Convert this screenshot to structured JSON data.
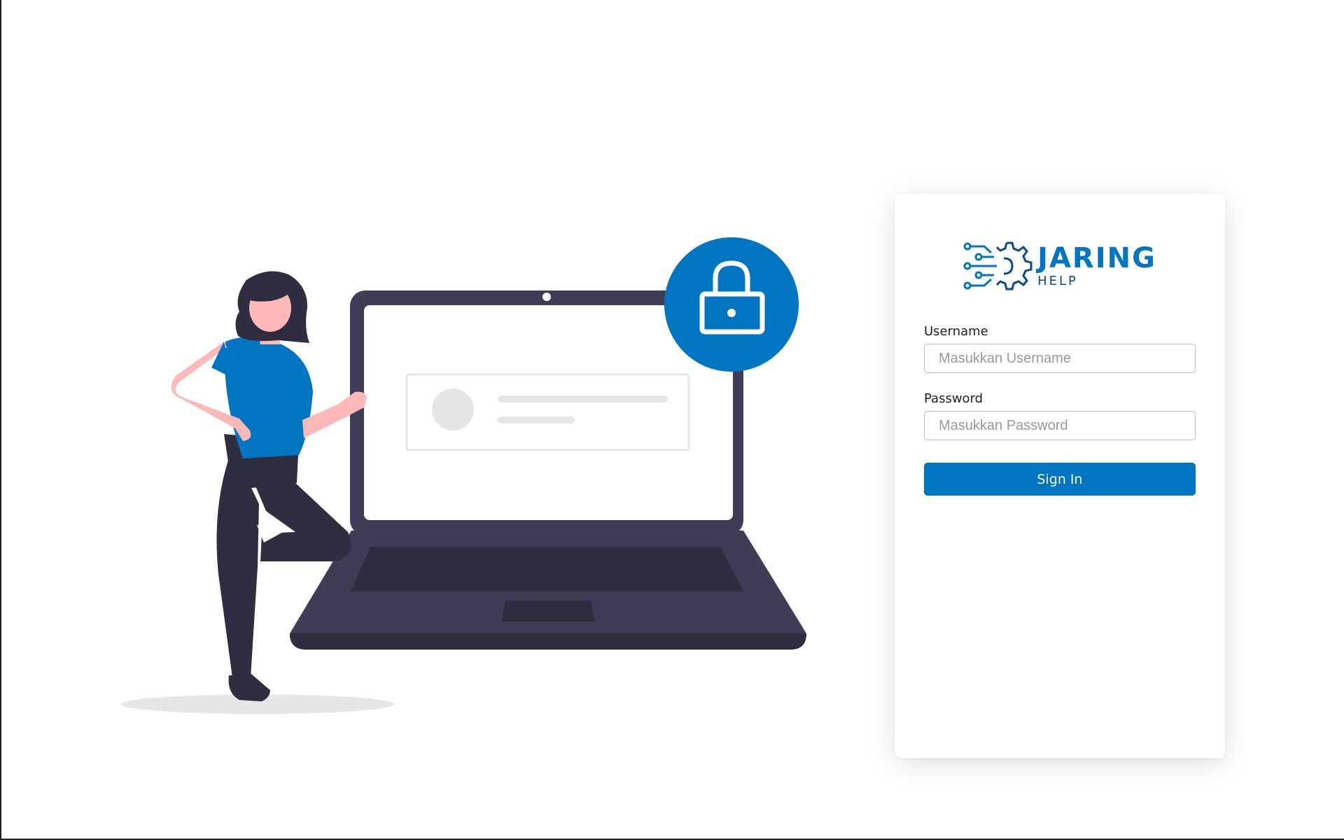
{
  "brand": {
    "name": "JARING",
    "subtitle": "HELP",
    "primary_color": "#0075c1",
    "dark_color": "#0b4a8b"
  },
  "illustration": {
    "description_icon": "person-with-laptop-lock-illustration",
    "lock_icon": "padlock-icon",
    "accent_color": "#0075c1",
    "laptop_color": "#3f3d56",
    "skin_color": "#ffb8b8"
  },
  "login": {
    "username_label": "Username",
    "username_placeholder": "Masukkan Username",
    "username_value": "",
    "password_label": "Password",
    "password_placeholder": "Masukkan Password",
    "password_value": "",
    "signin_label": "Sign In"
  }
}
